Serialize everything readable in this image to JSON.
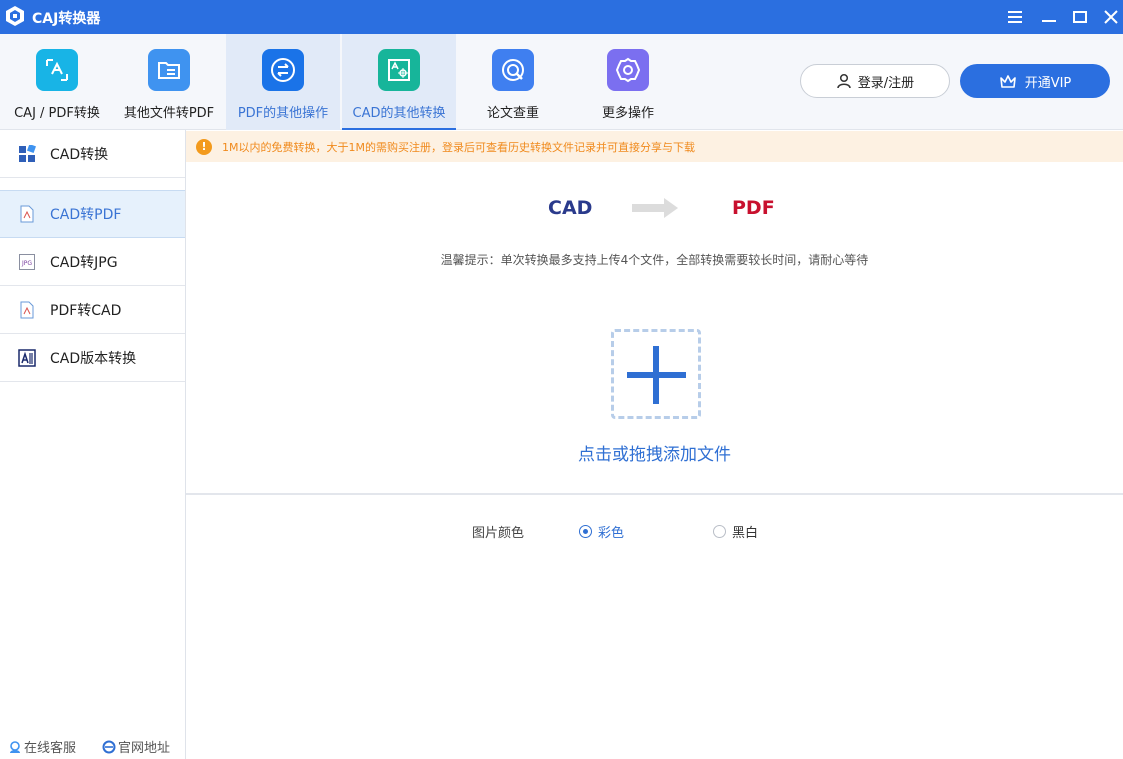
{
  "window": {
    "title": "CAJ转换器"
  },
  "toolbar": {
    "tools": [
      {
        "label": "CAJ / PDF转换",
        "icon": "caj-pdf-convert-icon",
        "color": "#18b4e6"
      },
      {
        "label": "其他文件转PDF",
        "icon": "folder-file-icon",
        "color": "#3f93f0"
      },
      {
        "label": "PDF的其他操作",
        "icon": "pdf-swap-icon",
        "color": "#1a73e8"
      },
      {
        "label": "CAD的其他转换",
        "icon": "cad-drawing-icon",
        "color": "#17b59a"
      },
      {
        "label": "论文查重",
        "icon": "paper-check-icon",
        "color": "#3f7ff0"
      },
      {
        "label": "更多操作",
        "icon": "gear-icon",
        "color": "#7b6ff0"
      }
    ],
    "login_label": "登录/注册",
    "vip_label": "开通VIP"
  },
  "sidebar": {
    "items": [
      {
        "label": "CAD转换",
        "icon": "grid-blocks-icon"
      },
      {
        "label": "CAD转PDF",
        "icon": "pdf-file-icon"
      },
      {
        "label": "CAD转JPG",
        "icon": "jpg-file-icon"
      },
      {
        "label": "PDF转CAD",
        "icon": "pdf-file-icon"
      },
      {
        "label": "CAD版本转换",
        "icon": "cad-version-icon"
      }
    ],
    "footer": {
      "support_label": "在线客服",
      "website_label": "官网地址"
    }
  },
  "notice": {
    "icon": "!",
    "text": "1M以内的免费转换，大于1M的需购买注册，登录后可查看历史转换文件记录并可直接分享与下载"
  },
  "main": {
    "from_format": "CAD",
    "to_format": "PDF",
    "tip": "温馨提示：单次转换最多支持上传4个文件，全部转换需要较长时间，请耐心等待",
    "drop_text": "点击或拖拽添加文件",
    "option_label": "图片颜色",
    "color_options": [
      {
        "label": "彩色",
        "checked": true
      },
      {
        "label": "黑白",
        "checked": false
      }
    ]
  }
}
